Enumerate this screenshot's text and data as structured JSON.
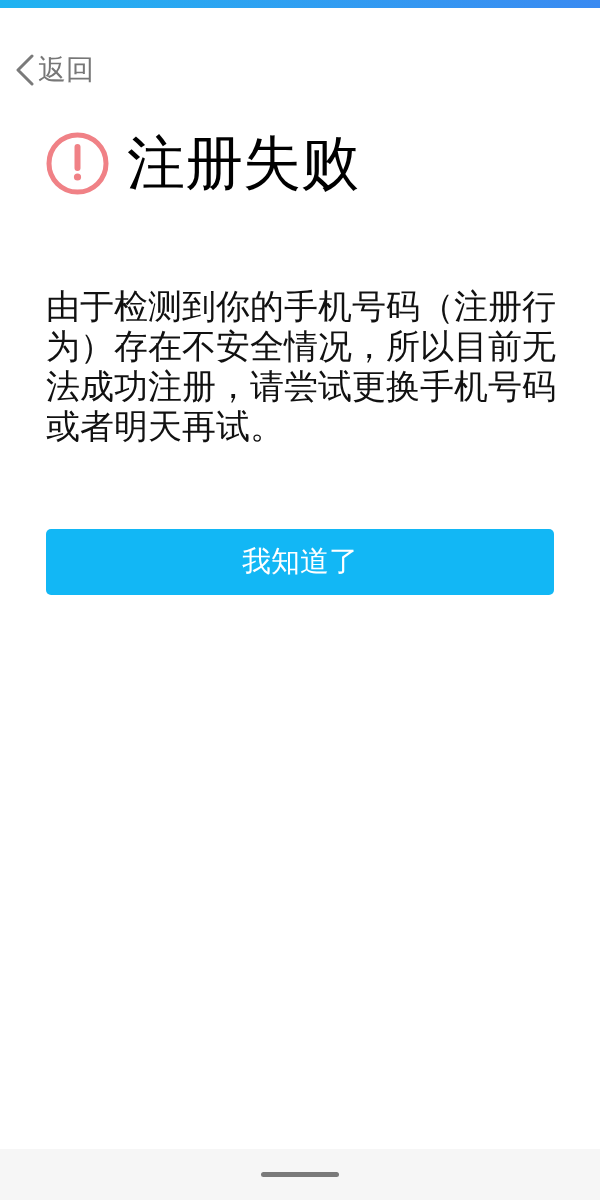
{
  "back": {
    "label": "返回"
  },
  "title": "注册失败",
  "message": "由于检测到你的手机号码（注册行为）存在不安全情况，所以目前无法成功注册，请尝试更换手机号码或者明天再试。",
  "button": {
    "label": "我知道了"
  }
}
